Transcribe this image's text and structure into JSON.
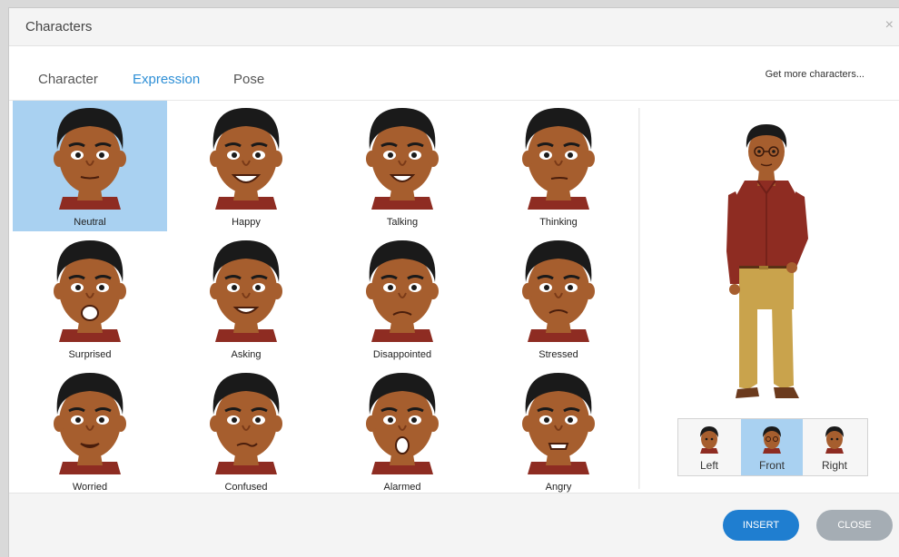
{
  "dialog": {
    "title": "Characters",
    "close_glyph": "×"
  },
  "tabs": [
    {
      "label": "Character",
      "active": false
    },
    {
      "label": "Expression",
      "active": true
    },
    {
      "label": "Pose",
      "active": false
    }
  ],
  "more_link": "Get more characters...",
  "expressions": [
    {
      "label": "Neutral",
      "selected": true
    },
    {
      "label": "Happy"
    },
    {
      "label": "Talking"
    },
    {
      "label": "Thinking"
    },
    {
      "label": "Surprised"
    },
    {
      "label": "Asking"
    },
    {
      "label": "Disappointed"
    },
    {
      "label": "Stressed"
    },
    {
      "label": "Worried"
    },
    {
      "label": "Confused"
    },
    {
      "label": "Alarmed"
    },
    {
      "label": "Angry"
    }
  ],
  "views": [
    {
      "label": "Left"
    },
    {
      "label": "Front",
      "selected": true
    },
    {
      "label": "Right"
    }
  ],
  "buttons": {
    "insert": "INSERT",
    "close": "CLOSE"
  },
  "colors": {
    "accent": "#2e8fd6",
    "selection": "#a9d1f1",
    "insert_button": "#1f7ed0",
    "close_button": "#a5adb4"
  }
}
